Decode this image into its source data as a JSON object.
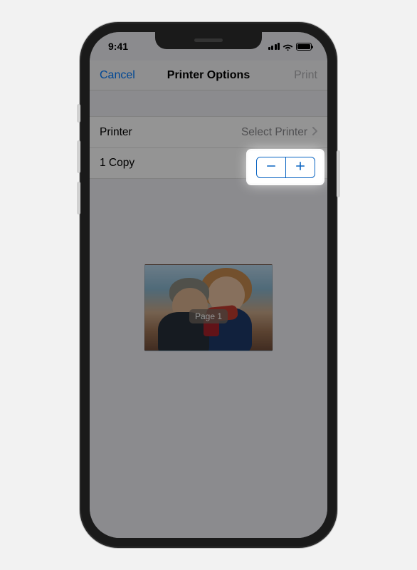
{
  "status": {
    "time": "9:41"
  },
  "nav": {
    "cancel": "Cancel",
    "title": "Printer Options",
    "print": "Print"
  },
  "rows": {
    "printer_label": "Printer",
    "printer_value": "Select Printer",
    "copies_label": "1 Copy"
  },
  "preview": {
    "page_label": "Page 1"
  }
}
